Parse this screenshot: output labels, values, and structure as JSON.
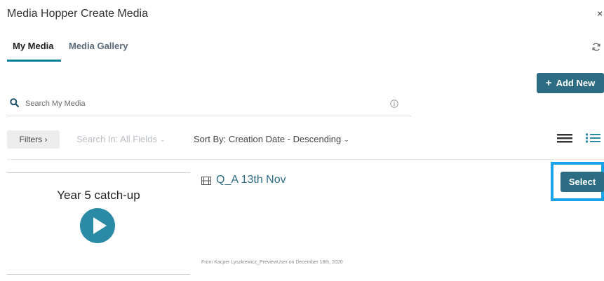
{
  "window": {
    "title": "Media Hopper Create Media",
    "close_glyph": "×"
  },
  "tabs": [
    {
      "label": "My Media",
      "active": true
    },
    {
      "label": "Media Gallery",
      "active": false
    }
  ],
  "toolbar": {
    "add_new_label": "Add New",
    "add_new_glyph": "+",
    "refresh_icon": "refresh-icon"
  },
  "search": {
    "placeholder": "Search My Media",
    "value": ""
  },
  "filters": {
    "filters_label": "Filters ›",
    "search_in_label": "Search In: All Fields",
    "sort_by_label": "Sort By: Creation Date - Descending",
    "caret_glyph": "⌄"
  },
  "entries": [
    {
      "thumbnail_title": "Year 5 catch-up",
      "title": "Q_A 13th Nov",
      "meta": "From Kacper Lyszkiewicz_PreviewUser on December 18th, 2020",
      "select_label": "Select"
    }
  ],
  "colors": {
    "accent": "#2c6d84",
    "tab_underline": "#0a7f9a",
    "play_button": "#2b8aa6",
    "select_highlight": "#1aa3e8"
  }
}
